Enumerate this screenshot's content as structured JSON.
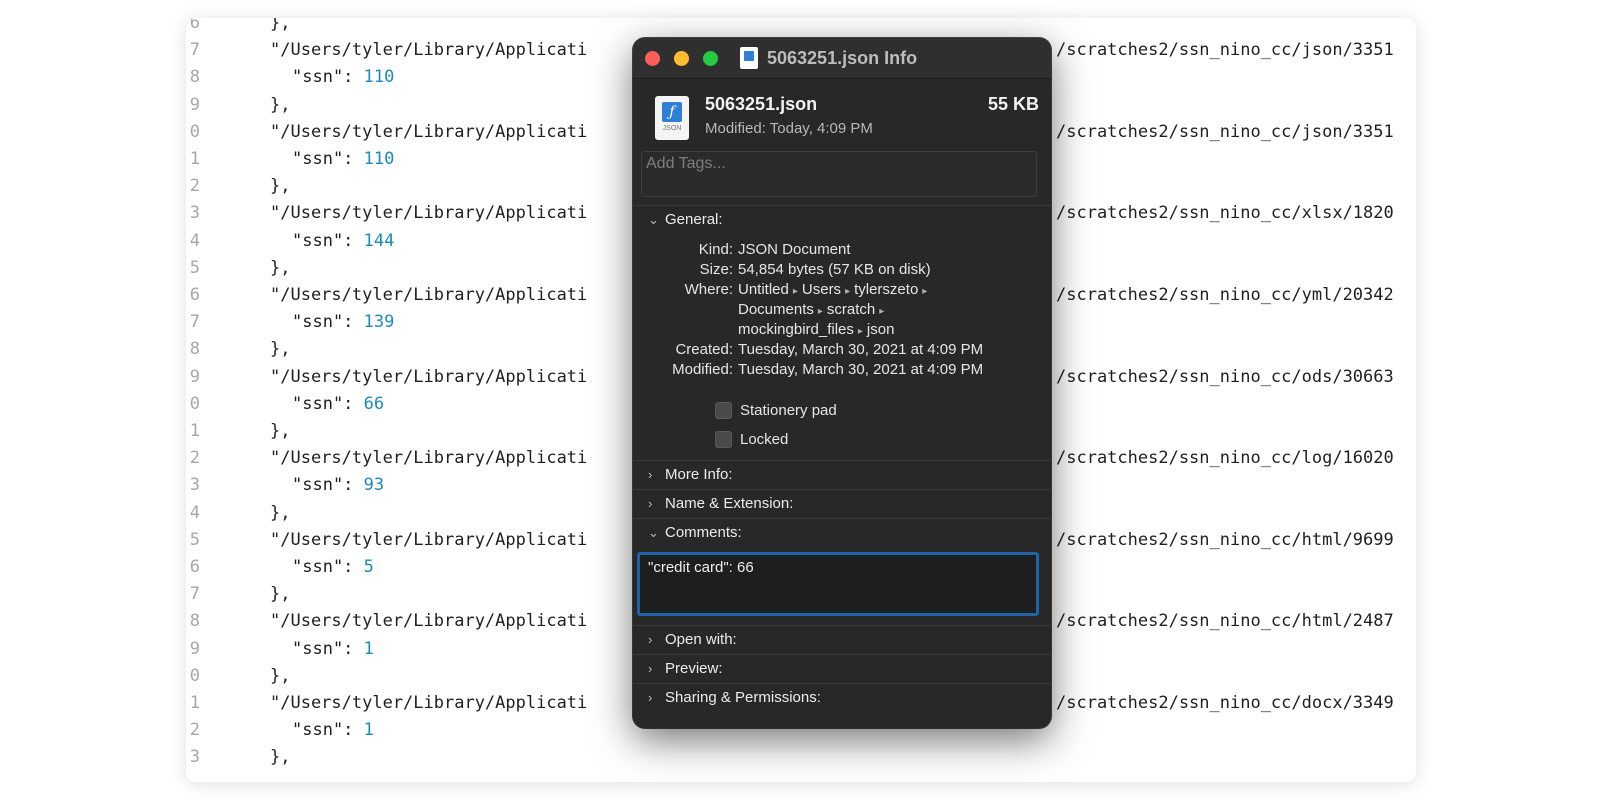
{
  "editor": {
    "lines": [
      {
        "ln": "6",
        "text": "},",
        "indent": 1
      },
      {
        "ln": "7",
        "text": "\"/Users/tyler/Library/Applicati",
        "right": "/scratches2/ssn_nino_cc/json/3351",
        "indent": 1
      },
      {
        "ln": "8",
        "key": "\"ssn\": ",
        "num": "110",
        "indent": 2
      },
      {
        "ln": "9",
        "text": "},",
        "indent": 1
      },
      {
        "ln": "0",
        "text": "\"/Users/tyler/Library/Applicati",
        "right": "/scratches2/ssn_nino_cc/json/3351",
        "indent": 1
      },
      {
        "ln": "1",
        "key": "\"ssn\": ",
        "num": "110",
        "indent": 2
      },
      {
        "ln": "2",
        "text": "},",
        "indent": 1
      },
      {
        "ln": "3",
        "text": "\"/Users/tyler/Library/Applicati",
        "right": "/scratches2/ssn_nino_cc/xlsx/1820",
        "indent": 1
      },
      {
        "ln": "4",
        "key": "\"ssn\": ",
        "num": "144",
        "indent": 2
      },
      {
        "ln": "5",
        "text": "},",
        "indent": 1
      },
      {
        "ln": "6",
        "text": "\"/Users/tyler/Library/Applicati",
        "right": "/scratches2/ssn_nino_cc/yml/20342",
        "indent": 1
      },
      {
        "ln": "7",
        "key": "\"ssn\": ",
        "num": "139",
        "indent": 2
      },
      {
        "ln": "8",
        "text": "},",
        "indent": 1
      },
      {
        "ln": "9",
        "text": "\"/Users/tyler/Library/Applicati",
        "right": "/scratches2/ssn_nino_cc/ods/30663",
        "indent": 1
      },
      {
        "ln": "0",
        "key": "\"ssn\": ",
        "num": "66",
        "indent": 2
      },
      {
        "ln": "1",
        "text": "},",
        "indent": 1
      },
      {
        "ln": "2",
        "text": "\"/Users/tyler/Library/Applicati",
        "right": "/scratches2/ssn_nino_cc/log/16020",
        "indent": 1
      },
      {
        "ln": "3",
        "key": "\"ssn\": ",
        "num": "93",
        "indent": 2
      },
      {
        "ln": "4",
        "text": "},",
        "indent": 1
      },
      {
        "ln": "5",
        "text": "\"/Users/tyler/Library/Applicati",
        "right": "/scratches2/ssn_nino_cc/html/9699",
        "indent": 1
      },
      {
        "ln": "6",
        "key": "\"ssn\": ",
        "num": "5",
        "indent": 2
      },
      {
        "ln": "7",
        "text": "},",
        "indent": 1
      },
      {
        "ln": "8",
        "text": "\"/Users/tyler/Library/Applicati",
        "right": "/scratches2/ssn_nino_cc/html/2487",
        "indent": 1
      },
      {
        "ln": "9",
        "key": "\"ssn\": ",
        "num": "1",
        "indent": 2
      },
      {
        "ln": "0",
        "text": "},",
        "indent": 1
      },
      {
        "ln": "1",
        "text": "\"/Users/tyler/Library/Applicati",
        "right": "/scratches2/ssn_nino_cc/docx/3349",
        "indent": 1
      },
      {
        "ln": "2",
        "key": "\"ssn\": ",
        "num": "1",
        "indent": 2
      },
      {
        "ln": "3",
        "text": "},",
        "indent": 1
      }
    ]
  },
  "info": {
    "window_title": "5063251.json Info",
    "file_name": "5063251.json",
    "file_size": "55 KB",
    "modified_label": "Modified:",
    "modified_value": "Today, 4:09 PM",
    "icon_label": "JSON",
    "tags_placeholder": "Add Tags...",
    "general_title": "General:",
    "kind_label": "Kind:",
    "kind_value": "JSON Document",
    "size_label": "Size:",
    "size_value": "54,854 bytes (57 KB on disk)",
    "where_label": "Where:",
    "where_path_1": [
      "Untitled",
      "Users",
      "tylerszeto"
    ],
    "where_path_2": [
      "Documents",
      "scratch"
    ],
    "where_path_3": [
      "mockingbird_files",
      "json"
    ],
    "created_label": "Created:",
    "created_value": "Tuesday, March 30, 2021 at 4:09 PM",
    "modified2_label": "Modified:",
    "modified2_value": "Tuesday, March 30, 2021 at 4:09 PM",
    "stationery_label": "Stationery pad",
    "locked_label": "Locked",
    "more_info_title": "More Info:",
    "name_ext_title": "Name & Extension:",
    "comments_title": "Comments:",
    "comment_text": "\"credit card\": 66",
    "open_with_title": "Open with:",
    "preview_title": "Preview:",
    "sharing_title": "Sharing & Permissions:"
  },
  "colors": {
    "close": "#fe5f57",
    "minimize": "#febc2e",
    "zoom": "#28c840",
    "accent": "#1e62a8",
    "number": "#1a8bbf"
  }
}
